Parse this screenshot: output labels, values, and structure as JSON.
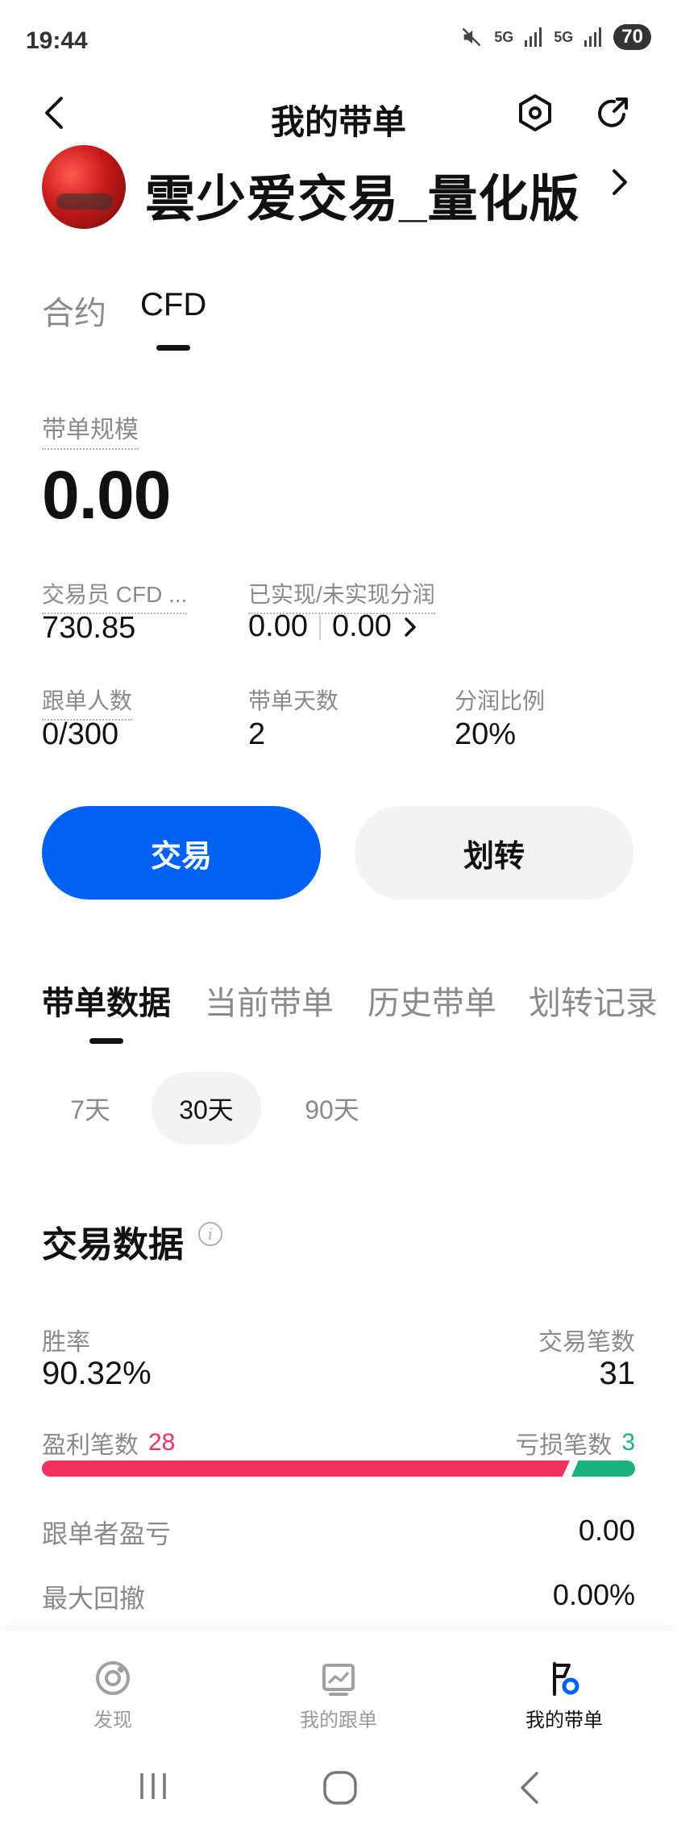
{
  "status_bar": {
    "time": "19:44",
    "battery": "70",
    "signal1": "5G",
    "signal2": "5G"
  },
  "header": {
    "title": "我的带单"
  },
  "profile": {
    "name": "雲少爱交易_量化版"
  },
  "product_tabs": [
    {
      "label": "合约",
      "active": false
    },
    {
      "label": "CFD",
      "active": true
    }
  ],
  "summary": {
    "scale_label": "带单规模",
    "scale_value": "0.00",
    "trader_cfd_label": "交易员 CFD ...",
    "trader_cfd_value": "730.85",
    "profit_share_label": "已实现/未实现分润",
    "realized": "0.00",
    "unrealized": "0.00",
    "followers_label": "跟单人数",
    "followers_value": "0/300",
    "days_label": "带单天数",
    "days_value": "2",
    "ratio_label": "分润比例",
    "ratio_value": "20%"
  },
  "buttons": {
    "trade": "交易",
    "transfer": "划转"
  },
  "section_tabs": [
    {
      "label": "带单数据",
      "active": true
    },
    {
      "label": "当前带单",
      "active": false
    },
    {
      "label": "历史带单",
      "active": false
    },
    {
      "label": "划转记录",
      "active": false
    }
  ],
  "periods": [
    {
      "label": "7天",
      "active": false
    },
    {
      "label": "30天",
      "active": true
    },
    {
      "label": "90天",
      "active": false
    }
  ],
  "trade_data": {
    "title": "交易数据",
    "win_rate_label": "胜率",
    "win_rate": "90.32%",
    "trade_count_label": "交易笔数",
    "trade_count": "31",
    "profit_count_label": "盈利笔数",
    "profit_count": "28",
    "loss_count_label": "亏损笔数",
    "loss_count": "3",
    "profit_fraction": 0.9032,
    "follower_pnl_label": "跟单者盈亏",
    "follower_pnl": "0.00",
    "max_drawdown_label": "最大回撤",
    "max_drawdown": "0.00%"
  },
  "colors": {
    "primary": "#0062f5",
    "profit": "#f2325e",
    "loss": "#1bb27f"
  },
  "bottom_nav": [
    {
      "label": "发现",
      "icon": "discover-icon",
      "active": false
    },
    {
      "label": "我的跟单",
      "icon": "chart-icon",
      "active": false
    },
    {
      "label": "我的带单",
      "icon": "flag-icon",
      "active": true
    }
  ]
}
